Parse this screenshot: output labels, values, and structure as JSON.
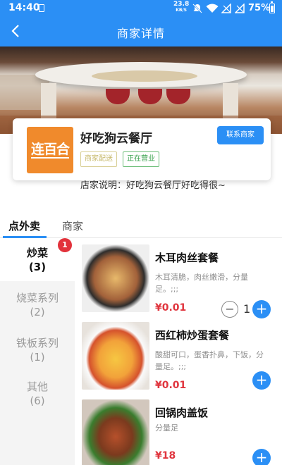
{
  "status_bar": {
    "time": "14:40",
    "net_speed": "23.8",
    "net_unit": "KB/S",
    "battery": "75%"
  },
  "header": {
    "title": "商家详情"
  },
  "shop": {
    "logo_text": "连百合",
    "name": "好吃狗云餐厅",
    "tags": [
      "商家配送",
      "正在营业"
    ],
    "contact_label": "联系商家",
    "description": "店家说明：好吃狗云餐厅好吃得很~"
  },
  "tabs": [
    "点外卖",
    "商家"
  ],
  "categories": [
    {
      "name": "炒菜",
      "count": "(3)",
      "badge": "1"
    },
    {
      "name": "烧菜系列",
      "count": "(2)"
    },
    {
      "name": "铁板系列",
      "count": "(1)"
    },
    {
      "name": "其他",
      "count": "(6)"
    }
  ],
  "dishes": [
    {
      "name": "木耳肉丝套餐",
      "desc": "木耳清脆，肉丝嫩滑，分量足。;;;",
      "price": "¥0.01",
      "qty": "1"
    },
    {
      "name": "西红柿炒蛋套餐",
      "desc": "酸甜可口，蛋香扑鼻，下饭，分量足。;;;",
      "price": "¥0.01"
    },
    {
      "name": "回锅肉盖饭",
      "desc": "分量足",
      "price": "¥18"
    }
  ],
  "colors": {
    "primary": "#2b8ff5",
    "price": "#e0353e",
    "badge": "#e2323b",
    "logo": "#f08a2c",
    "open_tag": "#35a04a"
  }
}
